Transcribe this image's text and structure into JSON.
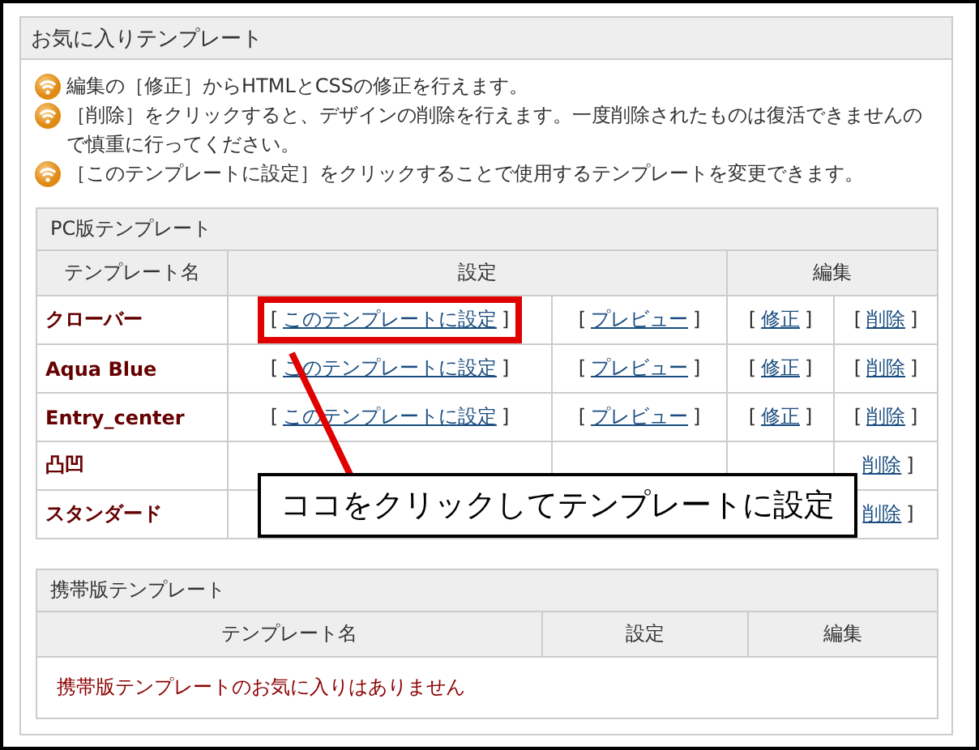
{
  "panel": {
    "title": "お気に入りテンプレート"
  },
  "notes": [
    "編集の［修正］からHTMLとCSSの修正を行えます。",
    "［削除］をクリックすると、デザインの削除を行えます。一度削除されたものは復活できませんので慎重に行ってください。",
    "［このテンプレートに設定］をクリックすることで使用するテンプレートを変更できます。"
  ],
  "pc_table": {
    "caption": "PC版テンプレート",
    "headers": [
      "テンプレート名",
      "設定",
      "編集"
    ],
    "rows": [
      {
        "name": "クローバー",
        "set_link": {
          "left": "[",
          "text": "このテンプレートに設定",
          "right": "]",
          "highlighted": true
        },
        "preview_link": {
          "left": "[",
          "text": "プレビュー",
          "right": "]"
        },
        "edit_link": {
          "left": "[",
          "text": "修正",
          "right": "]"
        },
        "delete_link": {
          "left": "[",
          "text": "削除",
          "right": "]"
        }
      },
      {
        "name": "Aqua Blue",
        "set_link": {
          "left": "[",
          "text": "このテンプレートに設定",
          "right": "]",
          "highlighted": false
        },
        "preview_link": {
          "left": "[",
          "text": "プレビュー",
          "right": "]"
        },
        "edit_link": {
          "left": "[",
          "text": "修正",
          "right": "]"
        },
        "delete_link": {
          "left": "[",
          "text": "削除",
          "right": "]"
        }
      },
      {
        "name": "Entry_center",
        "set_link": {
          "left": "[",
          "text": "このテンプレートに設定",
          "right": "]",
          "highlighted": false
        },
        "preview_link": {
          "left": "[",
          "text": "プレビュー",
          "right": "]"
        },
        "edit_link": {
          "left": "[",
          "text": "修正",
          "right": "]"
        },
        "delete_link": {
          "left": "[",
          "text": "削除",
          "right": "]"
        }
      },
      {
        "name": "凸凹",
        "delete_link": {
          "text": "削除",
          "right": "]"
        }
      },
      {
        "name": "スタンダード",
        "delete_link": {
          "text": "削除",
          "right": "]"
        }
      }
    ]
  },
  "mobile_table": {
    "caption": "携帯版テンプレート",
    "headers": [
      "テンプレート名",
      "設定",
      "編集"
    ],
    "empty_message": "携帯版テンプレートのお気に入りはありません"
  },
  "callout": {
    "text": "ココをクリックしてテンプレートに設定"
  }
}
